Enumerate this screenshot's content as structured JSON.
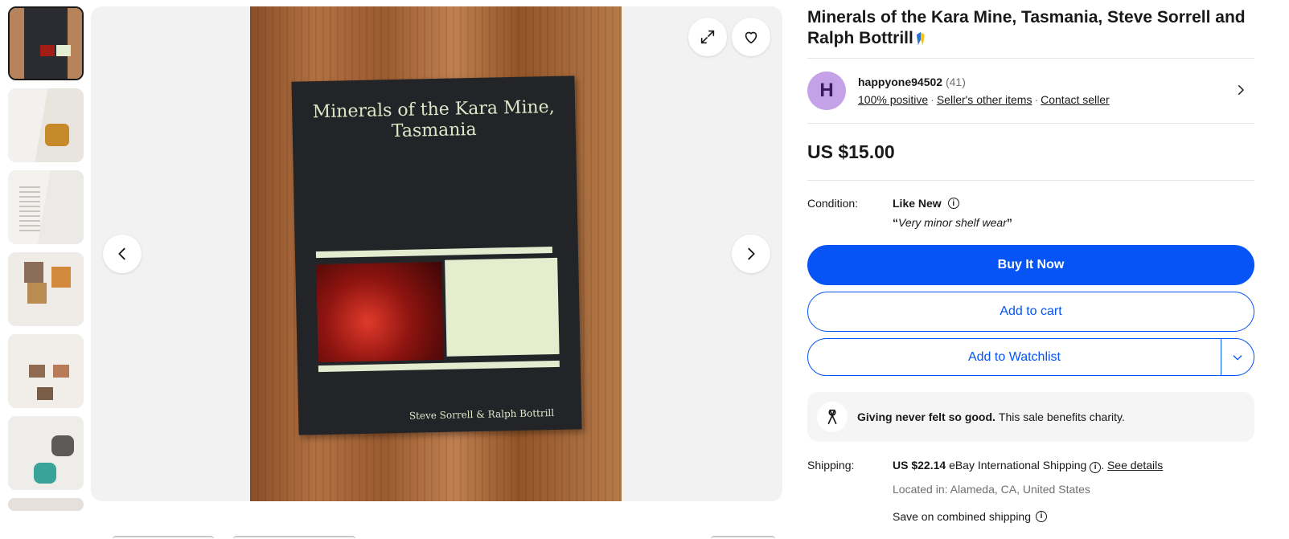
{
  "gallery": {
    "thumbnails": [
      "thumb-1",
      "thumb-2",
      "thumb-3",
      "thumb-4",
      "thumb-5",
      "thumb-6",
      "thumb-7"
    ],
    "book_title": "Minerals of the Kara Mine, Tasmania",
    "book_authors": "Steve Sorrell & Ralph Bottrill",
    "icons": {
      "expand": "expand-icon",
      "watch": "heart-icon",
      "prev": "chevron-left-icon",
      "next": "chevron-right-icon"
    }
  },
  "listing": {
    "title": "Minerals of the Kara Mine, Tasmania, Steve Sorrell and Ralph Bottrill",
    "price": "US $15.00"
  },
  "seller": {
    "avatar_letter": "H",
    "name": "happyone94502",
    "feedback_count": "(41)",
    "positive": "100% positive",
    "other_items": "Seller's other items",
    "contact": "Contact seller"
  },
  "condition": {
    "label": "Condition:",
    "value": "Like New",
    "note_open": "“",
    "note": "Very minor shelf wear",
    "note_close": "”"
  },
  "buttons": {
    "buy_now": "Buy It Now",
    "add_to_cart": "Add to cart",
    "add_to_watchlist": "Add to Watchlist"
  },
  "charity": {
    "headline": "Giving never felt so good.",
    "text": "This sale benefits charity."
  },
  "shipping": {
    "label": "Shipping:",
    "cost": "US $22.14",
    "service": "eBay International Shipping",
    "period": ".",
    "details_link": "See details",
    "location": "Located in: Alameda, CA, United States",
    "combined": "Save on combined shipping"
  },
  "colors": {
    "primary": "#0654f5",
    "text": "#191919",
    "muted": "#707070",
    "avatar_bg": "#c5a2e8"
  }
}
